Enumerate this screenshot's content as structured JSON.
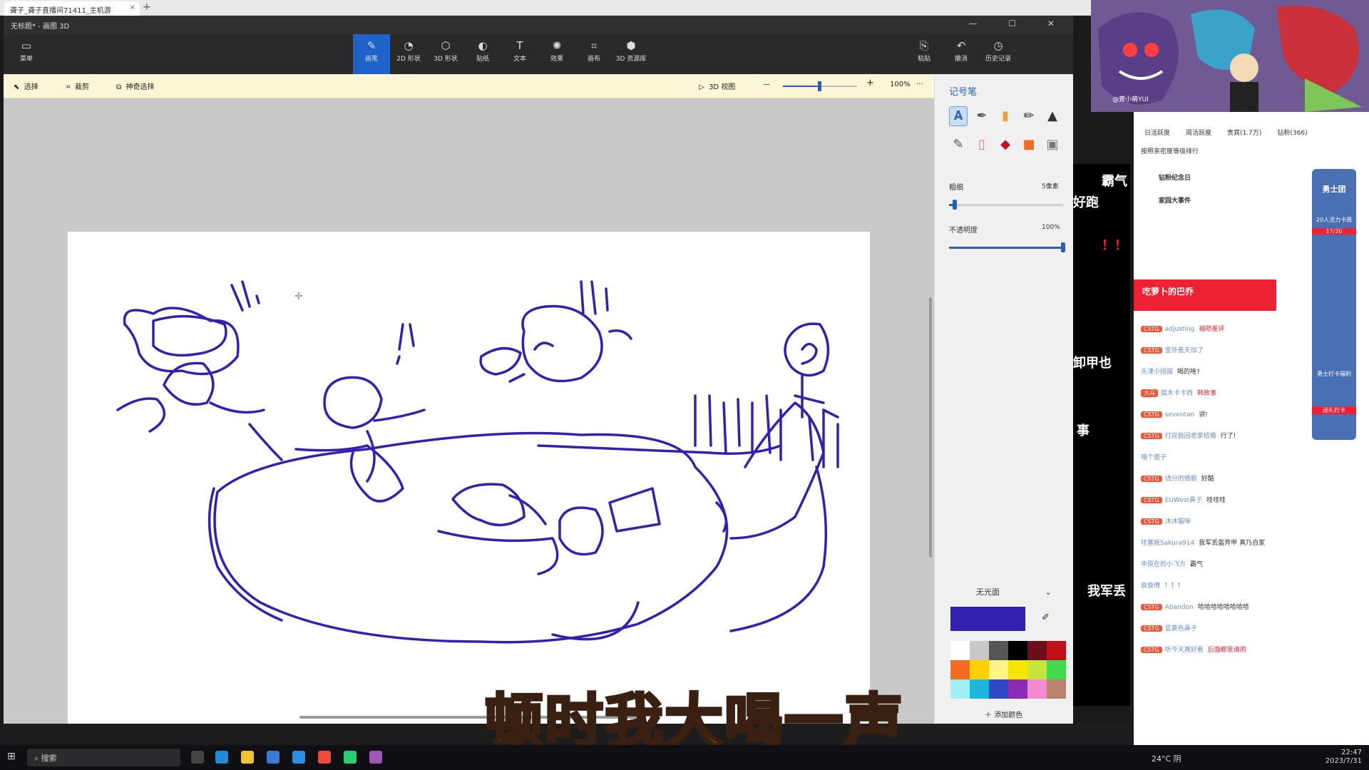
{
  "browser": {
    "tab_title": "聋子_聋子直播间71411_主机游",
    "new_tab": "+",
    "close": "×"
  },
  "paint3d": {
    "window_title": "无标题* - 画图 3D",
    "controls": "— ☐ ✕",
    "menu_label": "菜单",
    "ribbon_tools": [
      {
        "label": "画笔",
        "glyph": "✎",
        "active": true
      },
      {
        "label": "2D 形状",
        "glyph": "◔"
      },
      {
        "label": "3D 形状",
        "glyph": "⬡"
      },
      {
        "label": "贴纸",
        "glyph": "◐"
      },
      {
        "label": "文本",
        "glyph": "T"
      },
      {
        "label": "效果",
        "glyph": "✺"
      },
      {
        "label": "画布",
        "glyph": "⌗"
      },
      {
        "label": "3D 资源库",
        "glyph": "⬢"
      }
    ],
    "right_ribbon": [
      {
        "label": "粘贴",
        "glyph": "⎘"
      },
      {
        "label": "撤消",
        "glyph": "↶"
      },
      {
        "label": "历史记录",
        "glyph": "◷"
      }
    ],
    "subbar": {
      "select": "选择",
      "crop": "裁剪",
      "magic_select": "神奇选择",
      "view_3d": "3D 视图",
      "zoom": "100%",
      "zoom_level": 0.5,
      "more": "···",
      "minus": "—",
      "plus": "+"
    },
    "panel": {
      "title": "记号笔",
      "thickness_label": "粗细",
      "thickness_value": "5像素",
      "thickness_level": 0.05,
      "opacity_label": "不透明度",
      "opacity_value": "100%",
      "opacity_level": 1.0,
      "finish": "无光面",
      "add_color": "添加颜色",
      "current_color": "#3221b0",
      "brushes": [
        "𝐀",
        "✒",
        "▮",
        "✏",
        "▲",
        "✎",
        "▯",
        "◆",
        "■",
        "▣"
      ],
      "palette": [
        "#ffffff",
        "#c8c8c8",
        "#555555",
        "#000000",
        "#6b0f1a",
        "#c0121b",
        "#f26b21",
        "#ffd000",
        "#fff38a",
        "#f5e600",
        "#c5e53b",
        "#42d94f",
        "#9ff0f5",
        "#1fb5dc",
        "#3048c4",
        "#8d2ab3",
        "#f28ad0",
        "#b8836b"
      ]
    }
  },
  "stream": {
    "watermark": "@聋小萌YUI",
    "dark_texts": [
      "霸气",
      "好跑",
      "！！",
      "卸甲也",
      "事",
      "我军丢"
    ],
    "chat_tabs": [
      "日活跃度",
      "周活跃度",
      "贵宾(1.7万)",
      "钻粉(366)"
    ],
    "rank_banner": "按照亲密度等级排行",
    "events": [
      "钻粉纪念日",
      "家园大事件"
    ],
    "promo": "吃萝卜的巴乔",
    "side_badges": [
      "勇士团",
      "20人活力卡周",
      "17/20",
      "勇士打卡福利",
      "送礼打卡"
    ],
    "chat": [
      {
        "badge": "CSTG",
        "name": "adjusting",
        "msg": "福助差评"
      },
      {
        "badge": "CSTG",
        "name": "室外差天加了",
        "msg": ""
      },
      {
        "badge": "",
        "name": "天津小拐国",
        "msg": "喝的啥?"
      },
      {
        "badge": "大马",
        "name": "搞木卡卡西",
        "msg": "韩故事"
      },
      {
        "badge": "CSTG",
        "name": "seventan",
        "msg": "讲!"
      },
      {
        "badge": "CSTG",
        "name": "打完我回老家结婚",
        "msg": "行了!"
      },
      {
        "badge": "",
        "name": "喵个面子",
        "msg": ""
      },
      {
        "badge": "CSTG",
        "name": "请分的情歌",
        "msg": "好酷"
      },
      {
        "badge": "CSTG",
        "name": "EUWest鼻子",
        "msg": "哇哇哇"
      },
      {
        "badge": "CSTG",
        "name": "沐沐猫咪",
        "msg": ""
      },
      {
        "badge": "",
        "name": "哇塞我Sakura914",
        "msg": "我军丢盔弃甲 真乃自家"
      },
      {
        "badge": "",
        "name": "中原在的小飞方",
        "msg": "霸气"
      },
      {
        "badge": "",
        "name": "衰衰傅",
        "msg": "！！！"
      },
      {
        "badge": "CSTG",
        "name": "Abandon",
        "msg": "哈哈哈哈哈哈哈哈"
      },
      {
        "badge": "CSTG",
        "name": "蓝黄色鼻子",
        "msg": ""
      },
      {
        "badge": "CSTG",
        "name": "听今天真好看",
        "msg": "后面都是谁的"
      }
    ]
  },
  "subtitle": "顿时我大喝一声",
  "taskbar": {
    "search": "搜索",
    "weather": "24°C 阴",
    "time": "22:47",
    "date": "2023/7/31"
  }
}
